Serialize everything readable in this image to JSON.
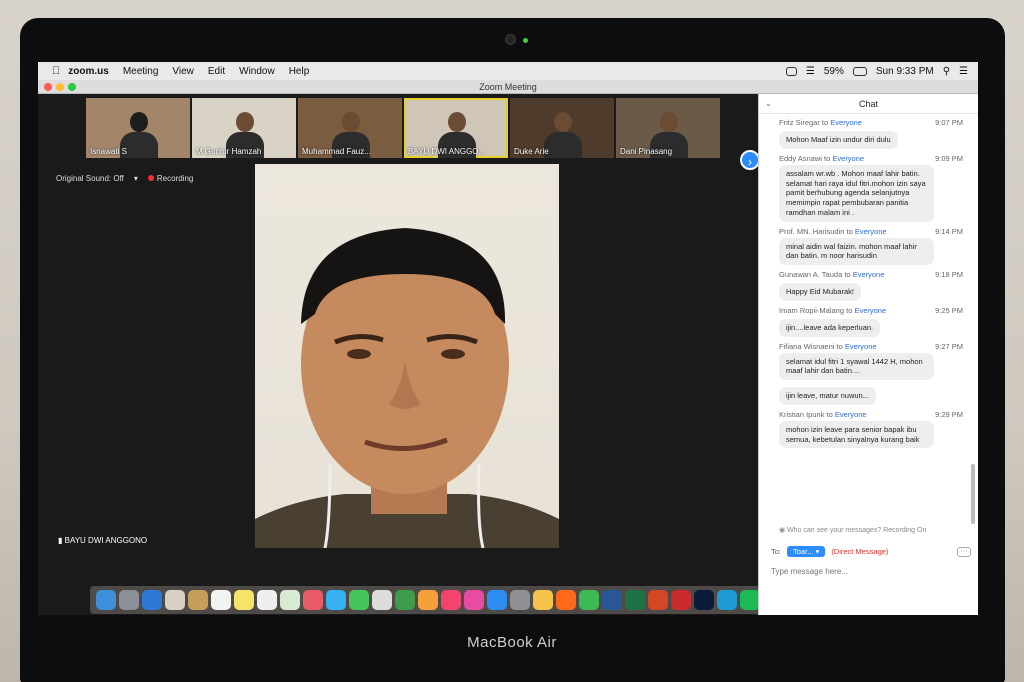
{
  "brand": "MacBook Air",
  "menubar": {
    "app": "zoom.us",
    "items": [
      "Meeting",
      "View",
      "Edit",
      "Window",
      "Help"
    ],
    "battery": "59%",
    "clock": "Sun 9:33 PM"
  },
  "window_title": "Zoom Meeting",
  "thumbnails": [
    {
      "name": "Isnawati S"
    },
    {
      "name": "M Guntur Hamzah"
    },
    {
      "name": "Muhammad Fauz..."
    },
    {
      "name": "BAYU DWI ANGGO..."
    },
    {
      "name": "Duke Arie"
    },
    {
      "name": "Dani Pinasang"
    }
  ],
  "audio": {
    "original_sound": "Original Sound: Off",
    "recording": "Recording"
  },
  "speaker_name": "BAYU DWI ANGGONO",
  "chat": {
    "title": "Chat",
    "messages": [
      {
        "sender": "Fritz Siregar",
        "to": "Everyone",
        "time": "9:07 PM",
        "text": "Mohon Maaf izin undur diri dulu"
      },
      {
        "sender": "Eddy Asnawi",
        "to": "Everyone",
        "time": "9:09 PM",
        "text": "assalam wr.wb . Mohon maaf lahir batin. selamat hari raya idul fitri.mohon izin saya pamit berhubung agenda selanjutnya memimpin rapat pembubaran panitia ramdhan malam ini ."
      },
      {
        "sender": "Prof. MN. Harisudin",
        "to": "Everyone",
        "time": "9:14 PM",
        "text": "minal aidin wal faizin. mohon maaf lahir dan batin. m noor harisudin"
      },
      {
        "sender": "Gunawan A. Tauda",
        "to": "Everyone",
        "time": "9:18 PM",
        "text": "Happy Eid Mubarak!"
      },
      {
        "sender": "Imam Ropii-Malang",
        "to": "Everyone",
        "time": "9:25 PM",
        "text": "ijin....leave ada keperluan."
      },
      {
        "sender": "Fifiana Wisnaeni",
        "to": "Everyone",
        "time": "9:27 PM",
        "text": "selamat idul fitri 1 syawal 1442 H, mohon maaf lahir dan batin...."
      },
      {
        "sender": "",
        "to": "",
        "time": "",
        "text": "ijin leave, matur nuwun..."
      },
      {
        "sender": "Kristian Ipunk",
        "to": "Everyone",
        "time": "9:29 PM",
        "text": "mohon izin leave para senior bapak ibu semua, kebetulan sinyalnya kurang baik"
      }
    ],
    "who_can_see": "Who can see your messages? Recording On",
    "to_label": "To:",
    "to_value": "Toar...",
    "direct_message": "(Direct Message)",
    "more": "···",
    "input_placeholder": "Type message here..."
  }
}
